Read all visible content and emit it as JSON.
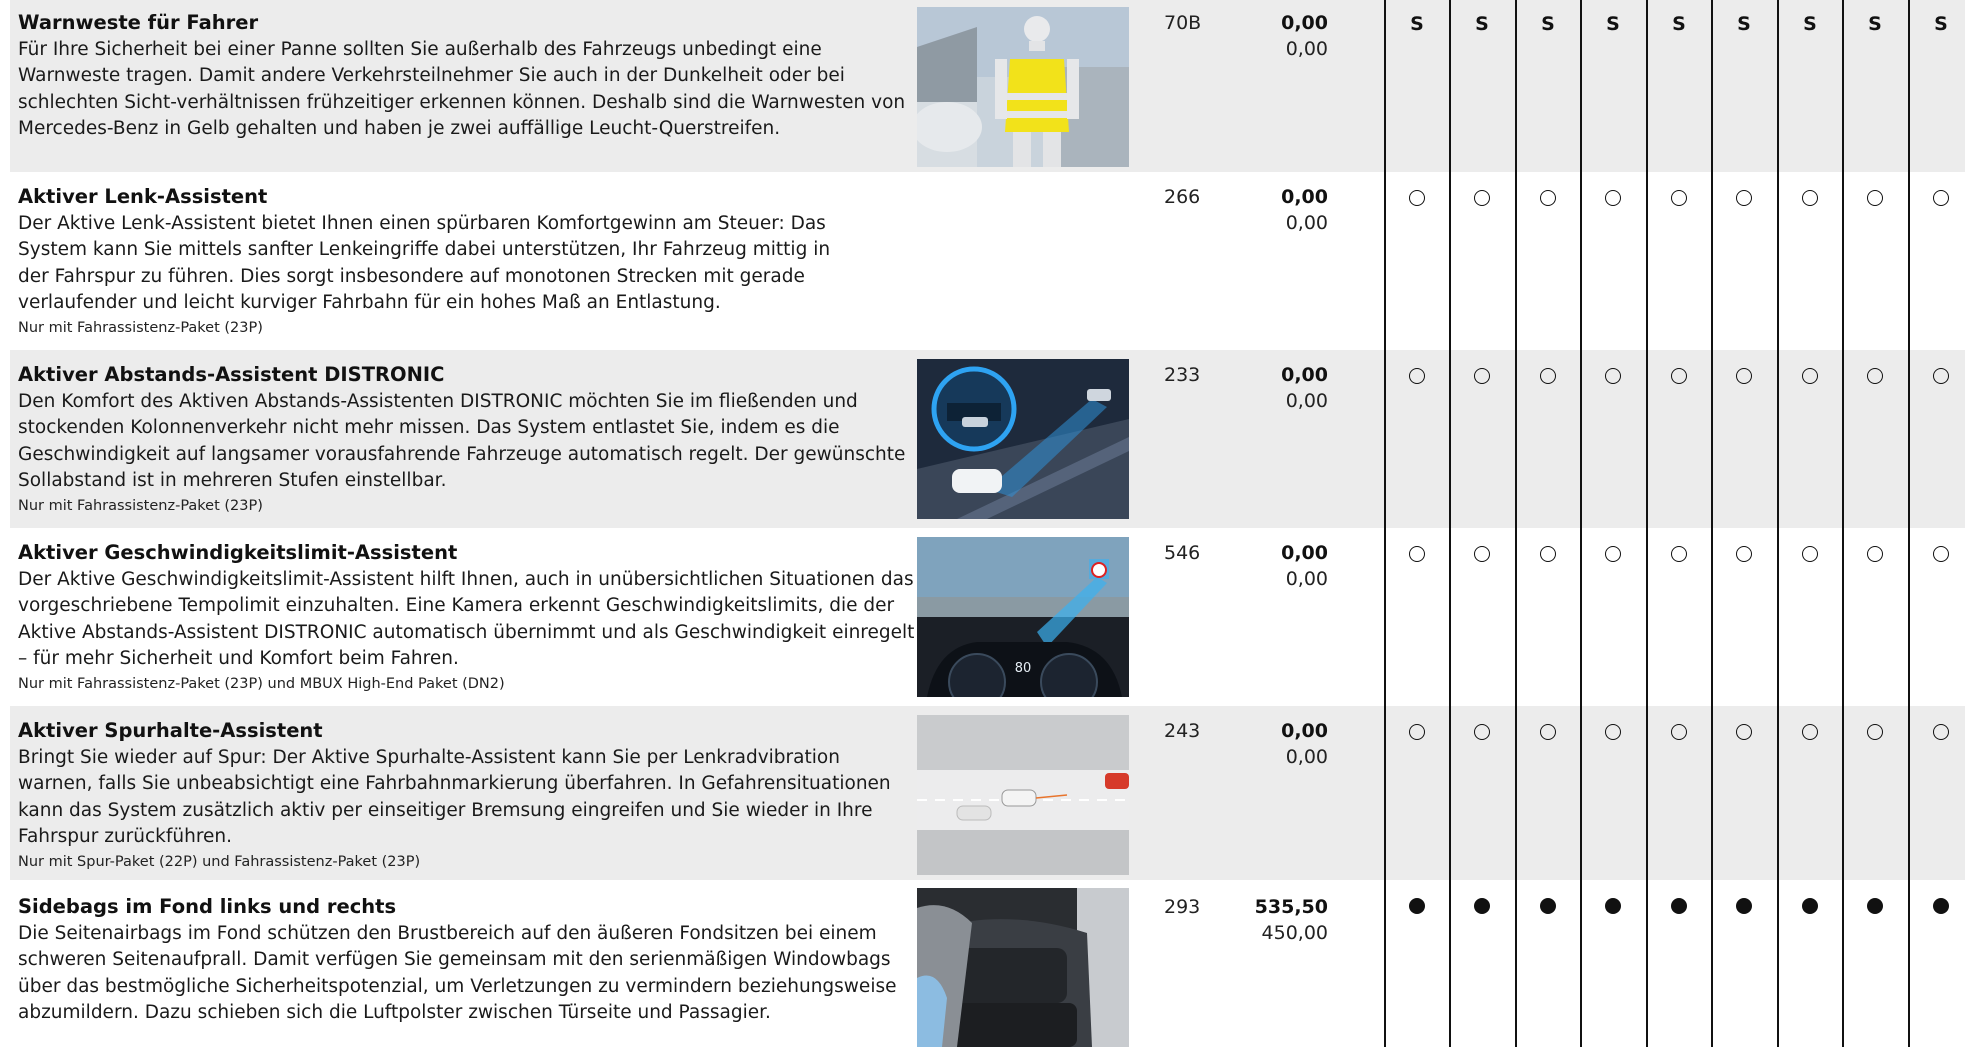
{
  "rows": [
    {
      "title": "Warnweste für Fahrer",
      "description": "Für Ihre Sicherheit bei einer Panne sollten Sie außerhalb des Fahrzeugs unbedingt eine Warnweste tragen. Damit andere Verkehrsteilnehmer Sie auch in der Dunkelheit oder bei schlechten Sicht-verhältnissen frühzeitiger erkennen können. Deshalb sind die Warnwesten von Mercedes-Benz in Gelb gehalten und haben je zwei auffällige Leucht-Querstreifen.",
      "note": "",
      "code": "70B",
      "price_gross": "0,00",
      "price_net": "0,00",
      "availability": "standard",
      "marks": [
        "S",
        "S",
        "S",
        "S",
        "S",
        "S",
        "S",
        "S",
        "S"
      ],
      "image": "warning-vest-image"
    },
    {
      "title": "Aktiver Lenk-Assistent",
      "description": "Der Aktive Lenk-Assistent bietet Ihnen einen spürbaren Komfortgewinn am Steuer: Das System kann Sie mittels sanfter Lenkeingriffe dabei unterstützen, Ihr Fahrzeug mittig in der Fahrspur zu führen. Dies sorgt insbesondere auf monotonen Strecken mit gerade verlaufender und leicht kurviger Fahrbahn für ein hohes Maß an Entlastung.",
      "note": "Nur mit Fahrassistenz-Paket (23P)",
      "code": "266",
      "price_gross": "0,00",
      "price_net": "0,00",
      "availability": "optional",
      "image": ""
    },
    {
      "title": "Aktiver Abstands-Assistent DISTRONIC",
      "description": "Den Komfort des Aktiven Abstands-Assistenten DISTRONIC möchten Sie im fließenden und stockenden Kolonnenverkehr nicht mehr missen. Das System entlastet Sie, indem es die Geschwindigkeit auf langsamer vorausfahrende Fahrzeuge automatisch regelt. Der gewünschte Sollabstand ist in mehreren Stufen einstellbar.",
      "note": "Nur mit Fahrassistenz-Paket (23P)",
      "code": "233",
      "price_gross": "0,00",
      "price_net": "0,00",
      "availability": "optional",
      "image": "distronic-image"
    },
    {
      "title": "Aktiver Geschwindigkeitslimit-Assistent",
      "description": "Der Aktive Geschwindigkeitslimit-Assistent hilft Ihnen, auch in unübersichtlichen Situationen das vorgeschriebene Tempolimit einzuhalten. Eine Kamera erkennt Geschwindigkeitslimits, die der Aktive Abstands-Assistent DISTRONIC automatisch übernimmt und als Geschwindigkeit einregelt – für mehr Sicherheit und Komfort beim Fahren.",
      "note": "Nur mit Fahrassistenz-Paket (23P) und MBUX High-End Paket (DN2)",
      "code": "546",
      "price_gross": "0,00",
      "price_net": "0,00",
      "availability": "optional",
      "image": "speed-limit-image",
      "image_speed": "80"
    },
    {
      "title": "Aktiver Spurhalte-Assistent",
      "description": "Bringt Sie wieder auf Spur: Der Aktive Spurhalte-Assistent kann Sie per Lenkradvibration warnen, falls Sie unbeabsichtigt eine Fahrbahnmarkierung überfahren. In Gefahrensituationen kann das System zusätzlich aktiv per einseitiger Bremsung eingreifen und Sie wieder in Ihre Fahrspur zurückführen.",
      "note": "Nur mit Spur-Paket (22P) und Fahrassistenz-Paket (23P)",
      "code": "243",
      "price_gross": "0,00",
      "price_net": "0,00",
      "availability": "optional",
      "image": "lane-keeping-image"
    },
    {
      "title": "Sidebags im Fond links und rechts",
      "description": "Die Seitenairbags im Fond schützen den Brustbereich auf den äußeren Fondsitzen bei einem schweren Seitenaufprall. Damit verfügen Sie gemeinsam mit den serienmäßigen Windowbags über das bestmögliche Sicherheitspotenzial, um Verletzungen zu vermindern beziehungsweise abzumildern. Dazu schieben sich die Luftpolster zwischen Türseite und Passagier.",
      "note": "",
      "code": "293",
      "price_gross": "535,50",
      "price_net": "450,00",
      "availability": "filled",
      "image": "rear-sidebags-image"
    }
  ],
  "colors": {
    "shaded_row": "#ececec",
    "text": "#111111",
    "vest_yellow": "#f2e21a"
  }
}
